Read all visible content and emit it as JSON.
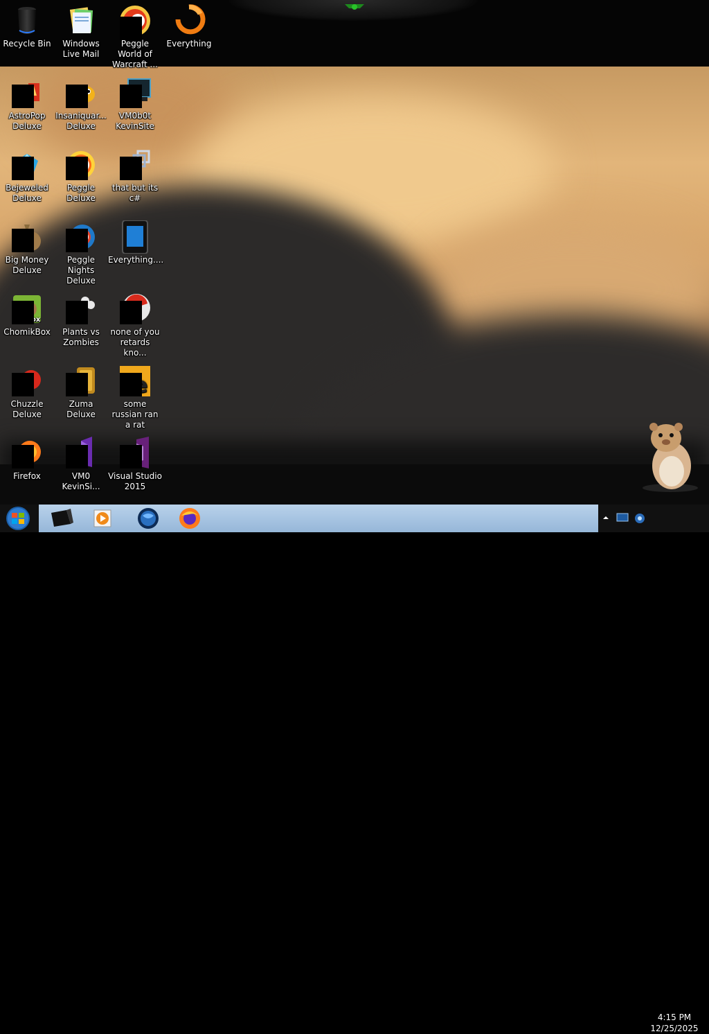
{
  "desktop": {
    "icons": [
      {
        "label": "Recycle Bin",
        "icon": "recycle-bin-icon"
      },
      {
        "label": "Windows Live Mail",
        "icon": "mail-icon"
      },
      {
        "label": "Peggle World of Warcraft ...",
        "icon": "peggle-icon"
      },
      {
        "label": "Everything",
        "icon": "everything-icon"
      },
      {
        "label": "AstroPop Deluxe",
        "icon": "astropop-icon"
      },
      {
        "label": "Insaniquar... Deluxe",
        "icon": "insaniquarium-icon"
      },
      {
        "label": "VM0b0t KevinSite",
        "icon": "monitor-icon"
      },
      {
        "label": "Bejeweled Deluxe",
        "icon": "gem-icon"
      },
      {
        "label": "Peggle Deluxe",
        "icon": "peggle-icon"
      },
      {
        "label": "that but its c#",
        "icon": "shortcut-icon"
      },
      {
        "label": "Big Money Deluxe",
        "icon": "money-bag-icon"
      },
      {
        "label": "Peggle Nights Deluxe",
        "icon": "peggle-nights-icon"
      },
      {
        "label": "Everything....",
        "icon": "tablet-icon"
      },
      {
        "label": "ChomikBox",
        "icon": "chomikbox-icon"
      },
      {
        "label": "Plants vs Zombies",
        "icon": "flower-icon"
      },
      {
        "label": "none of you retards kno...",
        "icon": "red-ball-icon"
      },
      {
        "label": "Chuzzle Deluxe",
        "icon": "chuzzle-icon"
      },
      {
        "label": "Zuma Deluxe",
        "icon": "zuma-icon"
      },
      {
        "label": "some russian ran a rat",
        "icon": "yellow-app-icon"
      },
      {
        "label": "Firefox",
        "icon": "firefox-icon"
      },
      {
        "label": "VM0 KevinSi...",
        "icon": "visual-studio-purple-icon"
      },
      {
        "label": "Visual Studio 2015",
        "icon": "visual-studio-icon"
      }
    ]
  },
  "taskbar": {
    "start": "start-orb-icon",
    "pinned": [
      "monitor-black-icon",
      "media-player-icon",
      "globe-icon",
      "firefox-icon"
    ],
    "clock": {
      "time": "4:15 PM",
      "date": "12/25/2025"
    }
  },
  "colors": {
    "taskbar_strip": "#a7c4e2",
    "text": "#ffffff",
    "accent_green": "#20c020"
  }
}
